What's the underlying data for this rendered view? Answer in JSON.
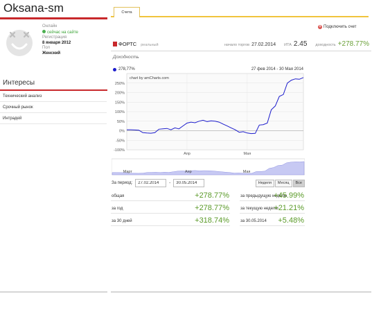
{
  "profile": {
    "username": "Oksana-sm",
    "status_label": "Онлайн",
    "status_value": "сейчас на сайте",
    "reg_label": "Регистрация",
    "reg_date": "8 января 2012",
    "gender_label": "Пол",
    "gender_value": "Женский"
  },
  "interests": {
    "title": "Интересы",
    "items": [
      "Технический анализ",
      "Срочный рынок",
      "Интрадей"
    ]
  },
  "tabs": [
    "Счета"
  ],
  "connect_label": "Подключить счет",
  "account": {
    "name": "ФОРТС",
    "type": "реальный",
    "start_label": "начало торгов",
    "start_value": "27.02.2014",
    "ita_label": "ИТА",
    "ita_value": "2.45",
    "return_label": "доходность",
    "return_value": "+278.77%"
  },
  "returns_title": "Доходность",
  "chart_data": {
    "type": "line",
    "series": [
      {
        "name": "278,77%",
        "color": "#1c1ccc",
        "values": [
          5,
          5,
          4,
          3,
          -10,
          -12,
          -13,
          -10,
          8,
          10,
          12,
          5,
          15,
          10,
          25,
          40,
          45,
          42,
          50,
          55,
          48,
          52,
          50,
          45,
          35,
          25,
          15,
          5,
          -8,
          -5,
          -12,
          -15,
          -14,
          30,
          32,
          40,
          110,
          130,
          180,
          190,
          250,
          265,
          272,
          270,
          278.77
        ]
      }
    ],
    "date_range": "27 фев 2014 - 30 Мая 2014",
    "watermark": "chart by amCharts.com",
    "y_ticks": [
      "250%",
      "200%",
      "150%",
      "100%",
      "50%",
      "0%",
      "-50%",
      "-100%"
    ],
    "x_ticks": [
      "Апр",
      "Мая"
    ],
    "nav_ticks": [
      "Март",
      "Апр",
      "Мая"
    ],
    "ylim": [
      -100,
      300
    ]
  },
  "period": {
    "label": "За период:",
    "from": "27.02.2014",
    "to": "30.05.2014",
    "separator": "-",
    "buttons": [
      "Неделя",
      "Месяц",
      "Все"
    ]
  },
  "stats": [
    {
      "label": "общая",
      "value": "+278.77%"
    },
    {
      "label": "за предыдущую неделю",
      "value": "+45.99%"
    },
    {
      "label": "за год",
      "value": "+278.77%"
    },
    {
      "label": "за текущую неделю",
      "value": "+21.21%"
    },
    {
      "label": "за 30 дней",
      "value": "+318.74%"
    },
    {
      "label": "за 30.05.2014",
      "value": "+5.48%"
    }
  ]
}
